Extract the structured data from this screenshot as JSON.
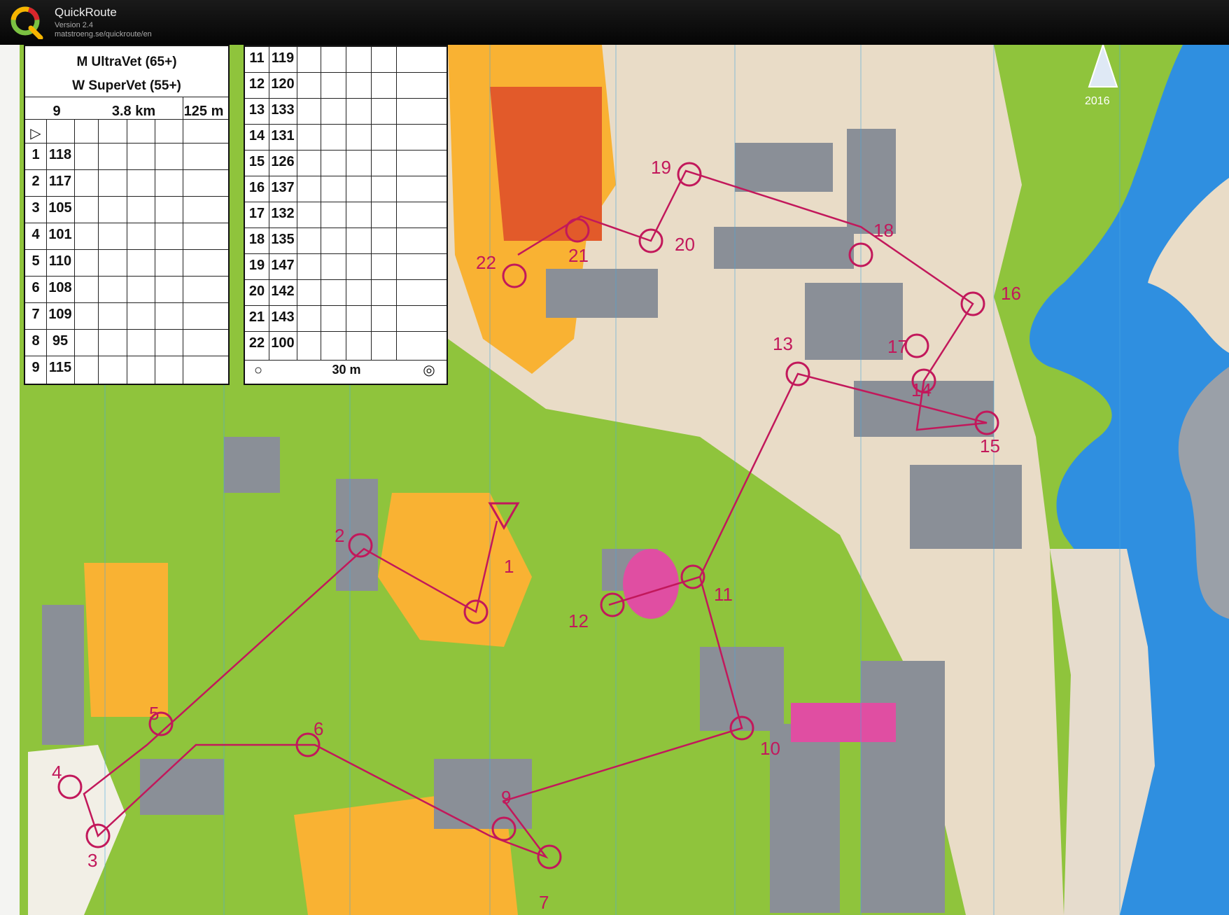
{
  "app": {
    "title": "QuickRoute",
    "version": "Version 2.4",
    "url": "matstroeng.se/quickroute/en"
  },
  "map": {
    "year_label": "2016"
  },
  "control_descriptions": {
    "class_1": "M UltraVet (65+)",
    "class_2": "W SuperVet (55+)",
    "course": "9",
    "length": "3.8 km",
    "climb": "125 m",
    "left_rows": [
      {
        "num": "1",
        "code": "118"
      },
      {
        "num": "2",
        "code": "117"
      },
      {
        "num": "3",
        "code": "105"
      },
      {
        "num": "4",
        "code": "101"
      },
      {
        "num": "5",
        "code": "110"
      },
      {
        "num": "6",
        "code": "108"
      },
      {
        "num": "7",
        "code": "109"
      },
      {
        "num": "8",
        "code": "95"
      },
      {
        "num": "9",
        "code": "115"
      }
    ],
    "right_rows": [
      {
        "num": "11",
        "code": "119"
      },
      {
        "num": "12",
        "code": "120"
      },
      {
        "num": "13",
        "code": "133"
      },
      {
        "num": "14",
        "code": "131"
      },
      {
        "num": "15",
        "code": "126"
      },
      {
        "num": "16",
        "code": "137"
      },
      {
        "num": "17",
        "code": "132"
      },
      {
        "num": "18",
        "code": "135"
      },
      {
        "num": "19",
        "code": "147"
      },
      {
        "num": "20",
        "code": "142"
      },
      {
        "num": "21",
        "code": "143"
      },
      {
        "num": "22",
        "code": "100"
      }
    ],
    "finish_distance": "30 m"
  },
  "control_labels": [
    "1",
    "2",
    "3",
    "4",
    "5",
    "6",
    "7",
    "9",
    "10",
    "11",
    "12",
    "13",
    "14",
    "15",
    "16",
    "17",
    "18",
    "19",
    "20",
    "21",
    "22"
  ],
  "colors": {
    "course_purple": "#c2185b",
    "green": "#8fc43c",
    "yellow": "#f9b233",
    "building": "#8a8f97",
    "water": "#2f8fe0",
    "paved": "#e9dcc7"
  }
}
